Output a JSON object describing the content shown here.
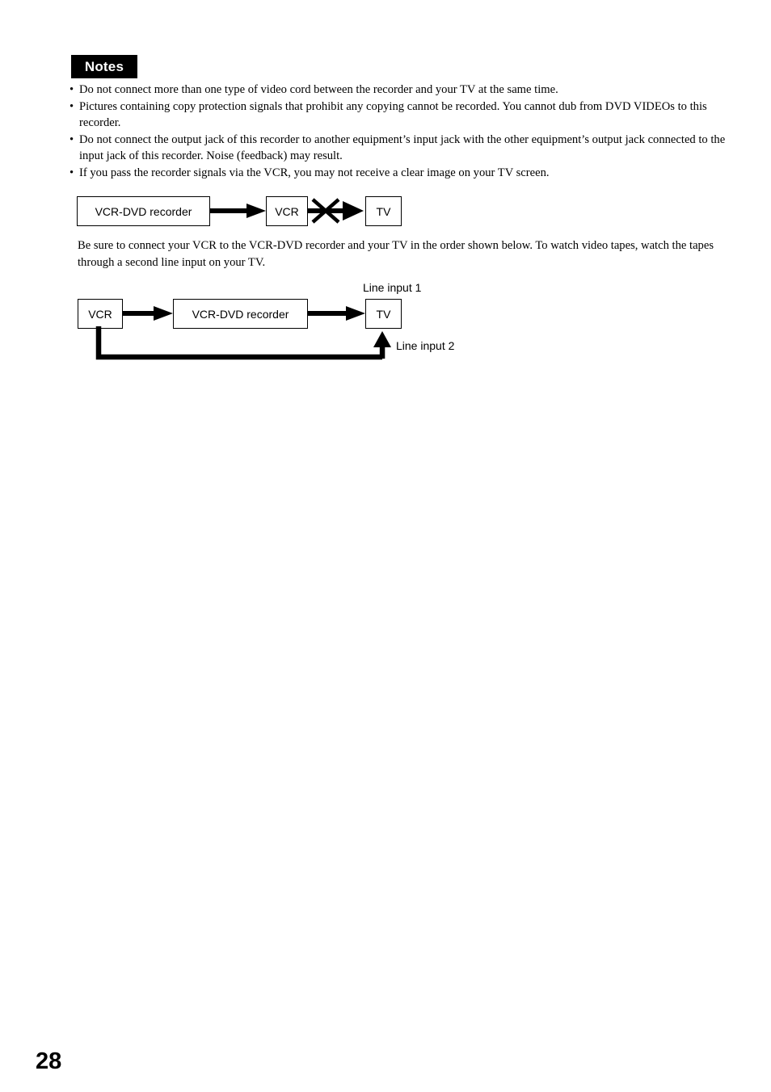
{
  "notes": {
    "header_label": "Notes",
    "bullet_glyph": "•",
    "items": [
      "Do not connect more than one type of video cord between the recorder and your TV at the same time.",
      "Pictures containing copy protection signals that prohibit any copying cannot be recorded. You cannot dub from DVD VIDEOs to this recorder.",
      "Do not connect the output jack of this recorder to another equipment’s input jack with the other equipment’s output jack connected to the input jack of this recorder. Noise (feedback) may result.",
      "If you pass the recorder signals via the VCR, you may not receive a clear image on your TV screen."
    ]
  },
  "diagram_prohibited": {
    "box1_label": "VCR-DVD recorder",
    "box2_label": "VCR",
    "box3_label": "TV"
  },
  "paragraph": "Be sure to connect your VCR to the VCR-DVD recorder and your TV in the order shown below. To watch video tapes, watch the tapes through a second line input on your TV.",
  "diagram_recommended": {
    "box1_label": "VCR",
    "box2_label": "VCR-DVD recorder",
    "box3_label": "TV",
    "line_input_1_label": "Line input 1",
    "line_input_2_label": "Line input 2"
  },
  "footer": {
    "page_number": "28"
  },
  "colors": {
    "ink": "#000000",
    "paper": "#ffffff"
  }
}
